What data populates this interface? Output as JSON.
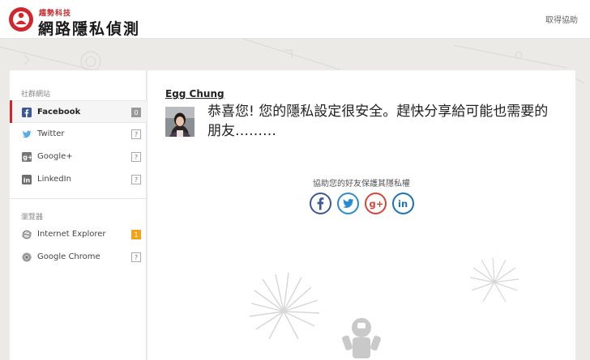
{
  "header": {
    "brand_top": "趨勢科技",
    "brand_title": "網路隱私偵測",
    "help_link": "取得協助"
  },
  "sidebar": {
    "social_label": "社群網站",
    "social_items": [
      {
        "label": "Facebook",
        "badge": "0",
        "icon": "facebook-icon",
        "active": true
      },
      {
        "label": "Twitter",
        "badge": "?",
        "icon": "twitter-icon"
      },
      {
        "label": "Google+",
        "badge": "?",
        "icon": "google-plus-icon"
      },
      {
        "label": "LinkedIn",
        "badge": "?",
        "icon": "linkedin-icon"
      }
    ],
    "browser_label": "瀏覽器",
    "browser_items": [
      {
        "label": "Internet Explorer",
        "badge": "1",
        "icon": "internet-explorer-icon"
      },
      {
        "label": "Google Chrome",
        "badge": "?",
        "icon": "google-chrome-icon"
      }
    ]
  },
  "main": {
    "user_name": "Egg Chung",
    "message": "恭喜您! 您的隱私設定很安全。趕快分享給可能也需要的朋友………",
    "share_label": "協助您的好友保護其隱私權",
    "share_buttons": [
      "facebook-share-icon",
      "twitter-share-icon",
      "google-plus-share-icon",
      "linkedin-share-icon"
    ]
  },
  "colors": {
    "brand_red": "#d2262c",
    "facebook": "#3b5998",
    "twitter": "#2a8ccf",
    "google_plus": "#d44638",
    "linkedin": "#1a73b5",
    "warning_badge": "#f2a21b"
  }
}
